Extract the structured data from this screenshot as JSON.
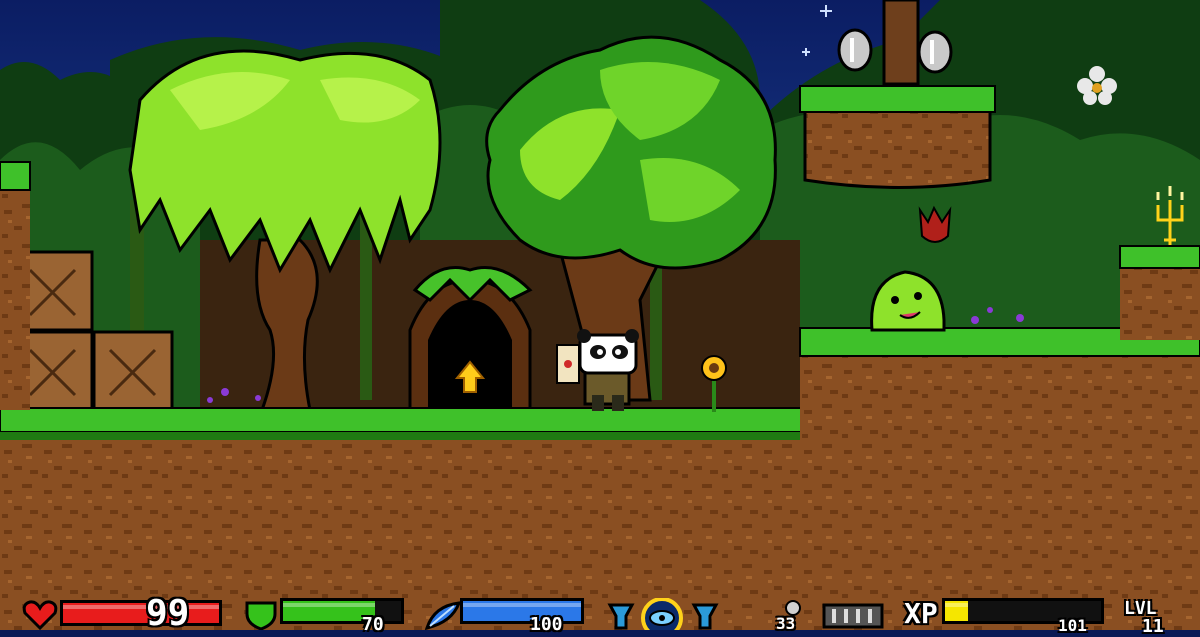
{
  "colors": {
    "sky": "#0b1d63",
    "sky_glow": "#2b5fb8",
    "grass": "#3fc12a",
    "dirt": "#8a4f22",
    "health": "#e81c1c",
    "armor": "#35c21b",
    "mana": "#2b78e8",
    "xp": "#f5e600"
  },
  "hud": {
    "health": {
      "value": "99",
      "fill": 1.0
    },
    "armor": {
      "value": "70",
      "fill": 0.78
    },
    "mana": {
      "value": "100",
      "fill": 1.0
    },
    "ammo": {
      "value": "33"
    },
    "xp": {
      "label": "XP",
      "value": "101",
      "fill": 0.15
    },
    "level": {
      "label": "LVL",
      "value": "11"
    },
    "icons": [
      "heart-icon",
      "shield-icon",
      "feather-icon",
      "potion-icon",
      "eye-icon",
      "potion-icon",
      "skull-icon",
      "key-icon"
    ]
  }
}
